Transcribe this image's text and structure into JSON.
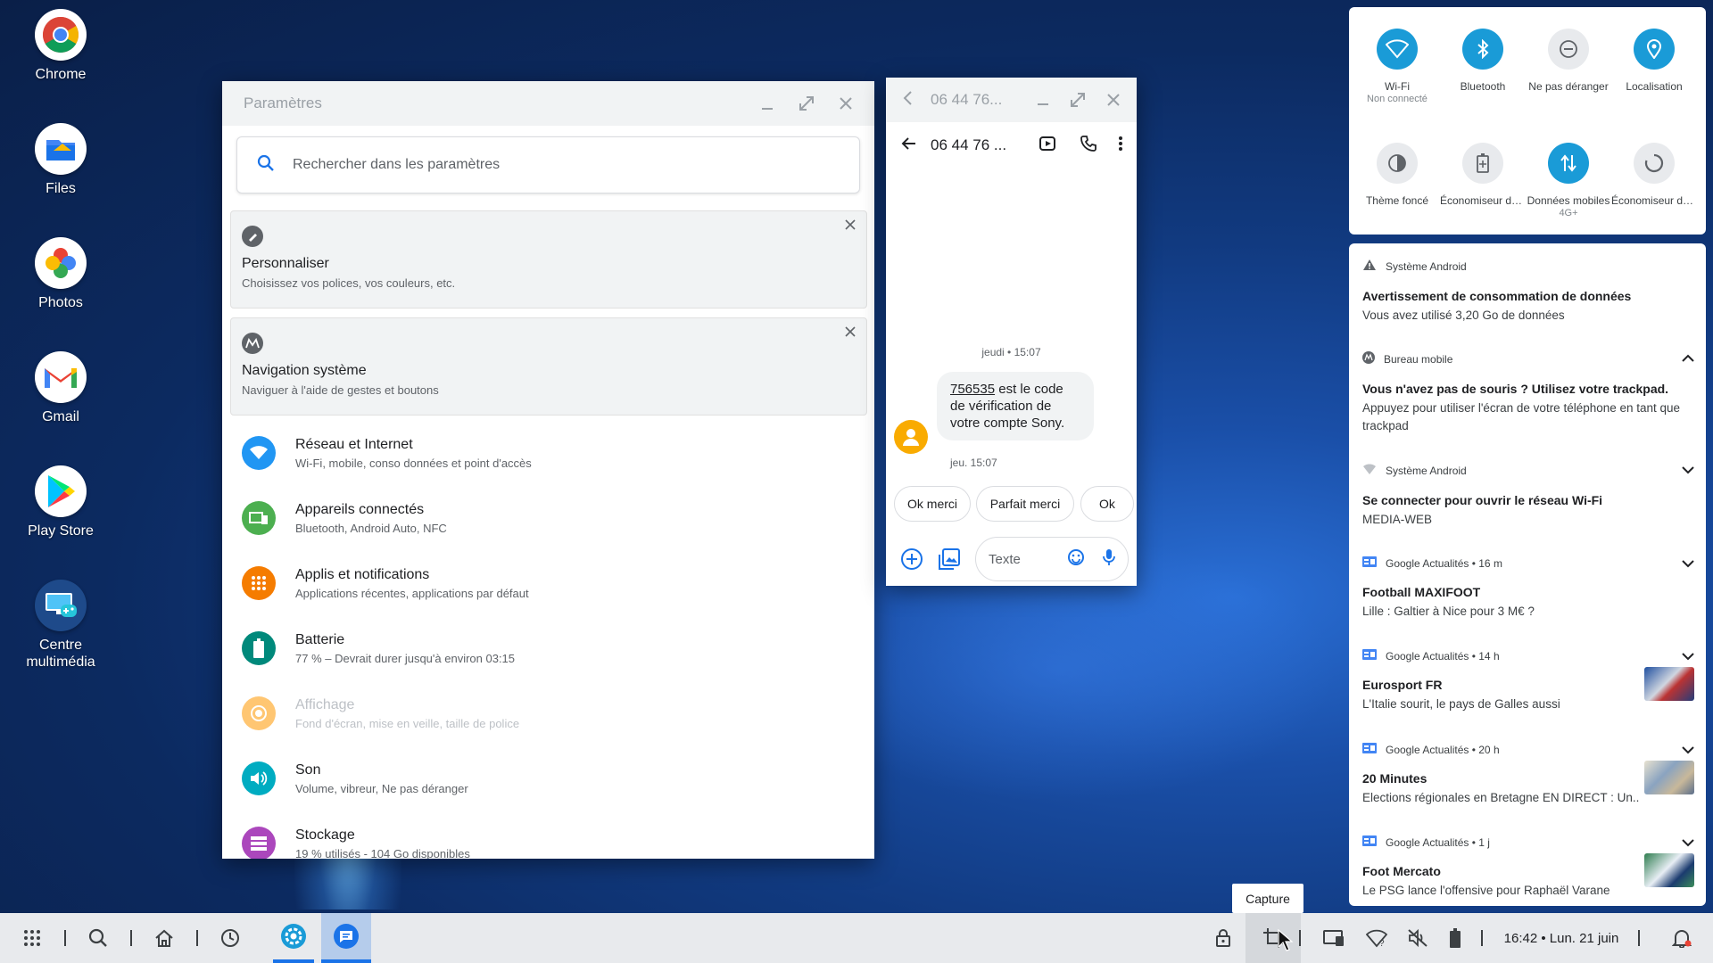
{
  "desktop": {
    "icons": [
      {
        "label": "Chrome"
      },
      {
        "label": "Files"
      },
      {
        "label": "Photos"
      },
      {
        "label": "Gmail"
      },
      {
        "label": "Play Store"
      },
      {
        "label": "Centre multimédia"
      }
    ]
  },
  "settings": {
    "title": "Paramètres",
    "search_placeholder": "Rechercher dans les paramètres",
    "suggestions": [
      {
        "title": "Personnaliser",
        "subtitle": "Choisissez vos polices, vos couleurs, etc."
      },
      {
        "title": "Navigation système",
        "subtitle": "Naviguer à l'aide de gestes et boutons"
      }
    ],
    "items": [
      {
        "title": "Réseau et Internet",
        "subtitle": "Wi-Fi, mobile, conso données et point d'accès",
        "color": "#2196f3"
      },
      {
        "title": "Appareils connectés",
        "subtitle": "Bluetooth, Android Auto, NFC",
        "color": "#4caf50"
      },
      {
        "title": "Applis et notifications",
        "subtitle": "Applications récentes, applications par défaut",
        "color": "#f57c00"
      },
      {
        "title": "Batterie",
        "subtitle": "77 % – Devrait durer jusqu'à environ 03:15",
        "color": "#00897b"
      },
      {
        "title": "Affichage",
        "subtitle": "Fond d'écran, mise en veille, taille de police",
        "color": "#ff9800"
      },
      {
        "title": "Son",
        "subtitle": "Volume, vibreur, Ne pas déranger",
        "color": "#00acc1"
      },
      {
        "title": "Stockage",
        "subtitle": "19 % utilisés - 104 Go disponibles",
        "color": "#ab47bc"
      }
    ]
  },
  "messages": {
    "window_title": "06 44 76...",
    "contact": "06 44 76 ...",
    "date_header": "jeudi • 15:07",
    "code": "756535",
    "message_rest": " est le code de vérification de votre compte Sony.",
    "timestamp": "jeu. 15:07",
    "replies": [
      "Ok merci",
      "Parfait merci",
      "Ok"
    ],
    "compose_placeholder": "Texte"
  },
  "quick_settings": {
    "tiles": [
      {
        "label": "Wi-Fi",
        "sub": "Non connecté",
        "icon": "wifi-icon"
      },
      {
        "label": "Bluetooth",
        "sub": "",
        "icon": "bluetooth-icon"
      },
      {
        "label": "Ne pas déranger",
        "sub": "",
        "icon": "dnd-icon"
      },
      {
        "label": "Localisation",
        "sub": "",
        "icon": "location-icon"
      },
      {
        "label": "Thème foncé",
        "sub": "",
        "icon": "dark-theme-icon"
      },
      {
        "label": "Économiseur de batterie",
        "sub": "",
        "icon": "battery-saver-icon"
      },
      {
        "label": "Données mobiles",
        "sub": "4G+",
        "icon": "mobile-data-icon"
      },
      {
        "label": "Économiseur de données",
        "sub": "",
        "icon": "data-saver-icon"
      }
    ]
  },
  "notifications": [
    {
      "app": "Système Android",
      "title": "Avertissement de consommation de données",
      "body": "Vous avez utilisé 3,20 Go de données"
    },
    {
      "app": "Bureau mobile",
      "title": "Vous n'avez pas de souris ? Utilisez votre trackpad.",
      "body": "Appuyez pour utiliser l'écran de votre téléphone en tant que trackpad"
    },
    {
      "app": "Système Android",
      "title": "Se connecter pour ouvrir le réseau Wi-Fi",
      "body": "MEDIA-WEB"
    },
    {
      "app": "Google Actualités • 16 m",
      "title": "Football MAXIFOOT",
      "body": "Lille : Galtier à Nice pour 3 M€ ?"
    },
    {
      "app": "Google Actualités • 14 h",
      "title": "Eurosport FR",
      "body": "L'Italie sourit, le pays de Galles aussi"
    },
    {
      "app": "Google Actualités • 20 h",
      "title": "20 Minutes",
      "body": "Elections régionales en Bretagne EN DIRECT : Un..."
    },
    {
      "app": "Google Actualités • 1 j",
      "title": "Foot Mercato",
      "body": "Le PSG lance l'offensive pour Raphaël Varane"
    }
  ],
  "taskbar": {
    "tooltip": "Capture",
    "clock": "16:42 • Lun. 21 juin"
  }
}
